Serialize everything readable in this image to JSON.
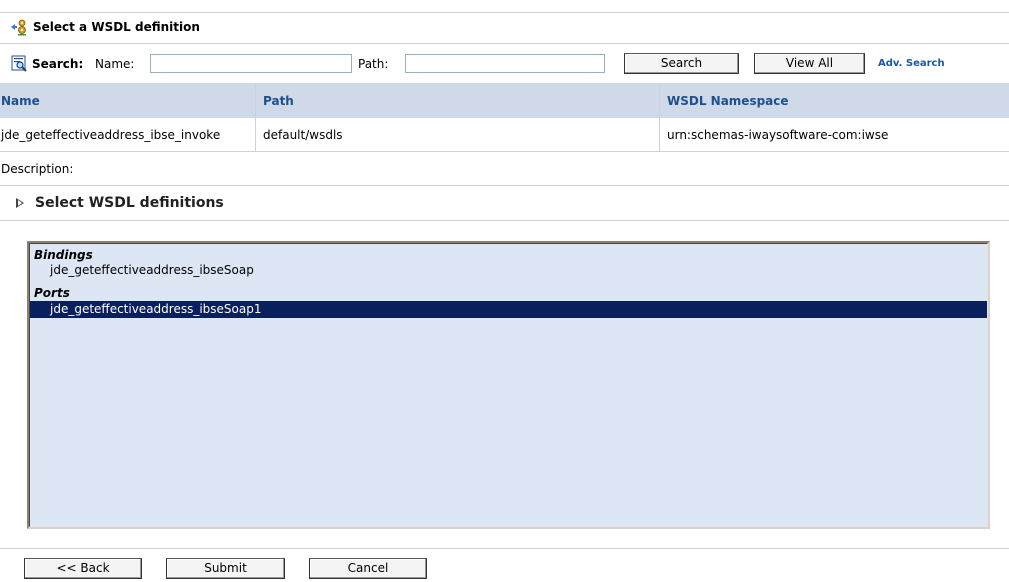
{
  "header": {
    "title": "Select a WSDL definition",
    "icon": "wsdl-gear-icon"
  },
  "search": {
    "label": "Search:",
    "name_label": "Name:",
    "name_value": "",
    "path_label": "Path:",
    "path_value": "",
    "search_button": "Search",
    "view_all_button": "View All",
    "adv_search_link": "Adv. Search"
  },
  "table": {
    "columns": [
      "Name",
      "Path",
      "WSDL Namespace"
    ],
    "rows": [
      {
        "name": "jde_geteffectiveaddress_ibse_invoke",
        "path": "default/wsdls",
        "namespace": "urn:schemas-iwaysoftware-com:iwse"
      }
    ]
  },
  "description": {
    "label": "Description:"
  },
  "section": {
    "title": "Select WSDL definitions"
  },
  "listbox": {
    "groups": [
      {
        "label": "Bindings",
        "options": [
          {
            "label": "jde_geteffectiveaddress_ibseSoap",
            "selected": false
          }
        ]
      },
      {
        "label": "Ports",
        "options": [
          {
            "label": "jde_geteffectiveaddress_ibseSoap1",
            "selected": true
          }
        ]
      }
    ]
  },
  "footer": {
    "back_button": "<< Back",
    "submit_button": "Submit",
    "cancel_button": "Cancel"
  },
  "colors": {
    "header_bg": "#cfd9e8",
    "header_text": "#1d4f91",
    "listbox_bg": "#dde6f4",
    "selection_bg": "#0a1f5e",
    "link": "#1a57a6"
  }
}
